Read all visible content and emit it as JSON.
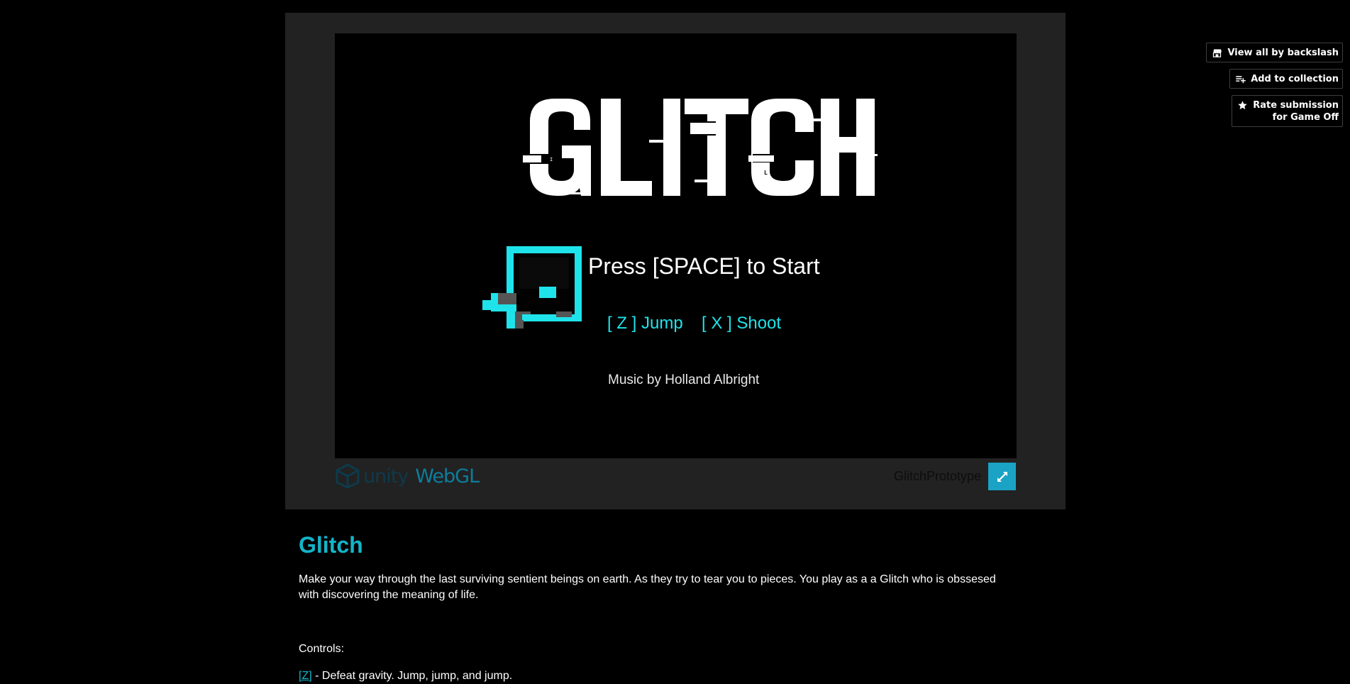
{
  "actions": {
    "view_all": "View all by backslash",
    "add_collection": "Add to collection",
    "rate": "Rate submission\nfor Game Off"
  },
  "game": {
    "logo_text": "GLITCH",
    "press_start": "Press [SPACE] to Start",
    "jump_hint": "[ Z ]  Jump",
    "shoot_hint": "[ X ] Shoot",
    "music_credit": "Music by Holland Albright",
    "build_title": "GlitchPrototype",
    "unity_word": "unity",
    "webgl_word": "WebGL",
    "accent_color": "#1fe3ea"
  },
  "page": {
    "title": "Glitch",
    "description": "Make your way through the last surviving sentient beings on earth. As they try to tear you to pieces. You play as a a Glitch who is obssesed with discovering the meaning of life.",
    "controls_heading": "Controls:",
    "controls": [
      {
        "key": "[Z]",
        "text": " - Defeat gravity. Jump, jump, and jump."
      }
    ]
  },
  "icons": {
    "view_all": "store-icon",
    "add_collection": "playlist-add-icon",
    "rate": "star-icon",
    "fullscreen": "fullscreen-icon",
    "unity": "unity-logo-icon"
  }
}
